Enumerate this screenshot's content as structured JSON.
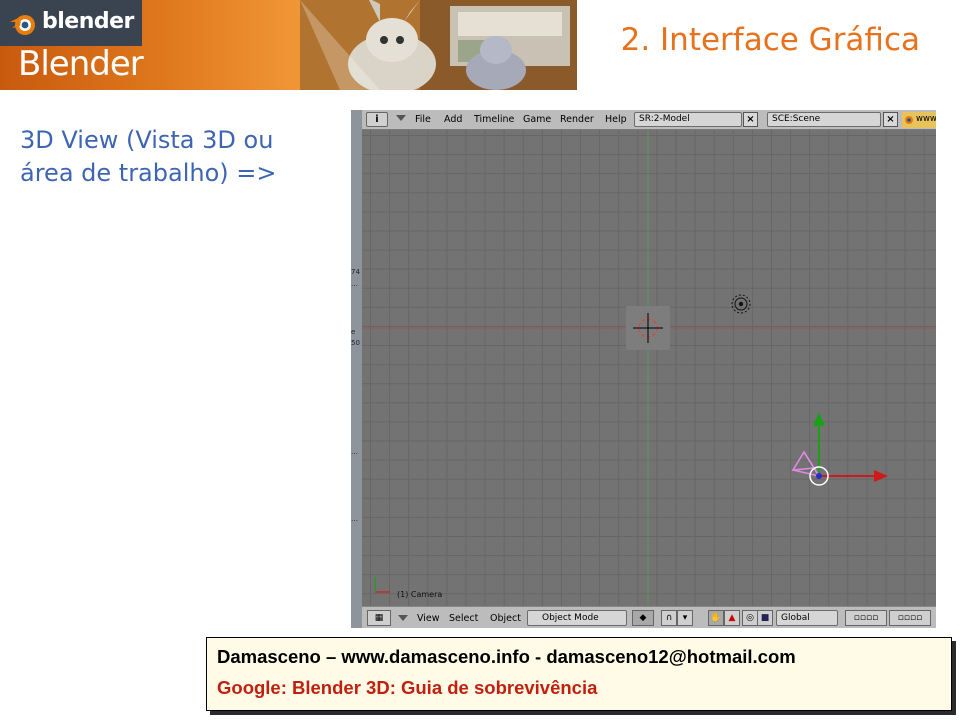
{
  "banner": {
    "logo_text": "blender",
    "title": "Blender"
  },
  "slide": {
    "title": "2. Interface Gráfica",
    "caption_line1": "3D View (Vista 3D ou",
    "caption_line2": "área de trabalho) =>"
  },
  "blender": {
    "header": {
      "menus": [
        "File",
        "Add",
        "Timeline",
        "Game",
        "Render",
        "Help"
      ],
      "screen_field": "SR:2-Model",
      "scene_field": "SCE:Scene",
      "www_label": "www"
    },
    "left_strip_marks": [
      "74",
      "…",
      "e",
      "50",
      "…",
      "…"
    ],
    "viewport": {
      "object_label": "(1) Camera"
    },
    "footer": {
      "menus": [
        "View",
        "Select",
        "Object"
      ],
      "mode": "Object Mode",
      "orientation": "Global"
    }
  },
  "credit": {
    "line1": "Damasceno – www.damasceno.info - damasceno12@hotmail.com",
    "line2": "Google: Blender 3D: Guia de sobrevivência"
  },
  "colors": {
    "title_orange": "#e8721c",
    "caption_blue": "#3e65b4",
    "credit_red": "#c2200f",
    "credit_bg": "#fffbe7",
    "viewport_bg": "#737373"
  }
}
